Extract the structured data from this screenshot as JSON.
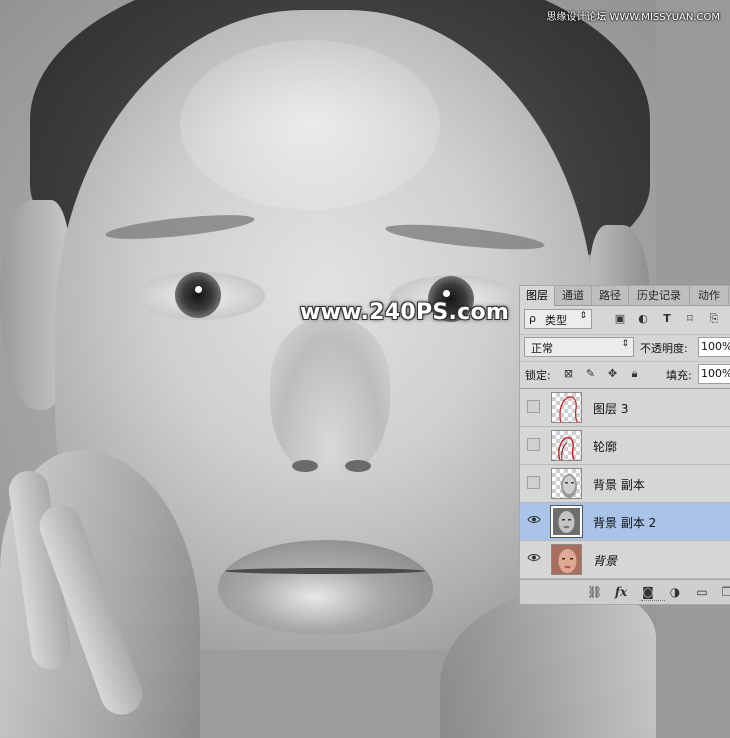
{
  "watermark": "www.240PS.com",
  "site_mark": "思缘设计论坛 WWW.MISSYUAN.COM",
  "panel": {
    "tabs": [
      "图层",
      "通道",
      "路径",
      "历史记录",
      "动作"
    ],
    "filter": {
      "label": "类型",
      "search_glyph": "ρ"
    },
    "filter_icons": [
      "image-filter-icon",
      "adjustment-filter-icon",
      "type-filter-icon",
      "shape-filter-icon",
      "smart-object-filter-icon"
    ],
    "blend_mode": "正常",
    "opacity_label": "不透明度:",
    "opacity_value": "100%",
    "lock_label": "锁定:",
    "fill_label": "填充:",
    "fill_value": "100%",
    "layers": [
      {
        "name": "图层 3",
        "visible": false,
        "selected": false
      },
      {
        "name": "轮廓",
        "visible": false,
        "selected": false
      },
      {
        "name": "背景 副本",
        "visible": false,
        "selected": false
      },
      {
        "name": "背景 副本 2",
        "visible": true,
        "selected": true
      },
      {
        "name": "背景",
        "visible": true,
        "selected": false,
        "italic": true
      }
    ],
    "footer_icons": [
      "link-layers-icon",
      "fx-icon",
      "add-mask-icon",
      "new-adjustment-icon",
      "new-group-icon",
      "new-layer-icon"
    ],
    "fx_label": "fx"
  },
  "colors": {
    "panel_bg": "#d6d6d6",
    "selected_row": "#a9c4e8",
    "thumb_outline_red": "#c81e1e"
  }
}
